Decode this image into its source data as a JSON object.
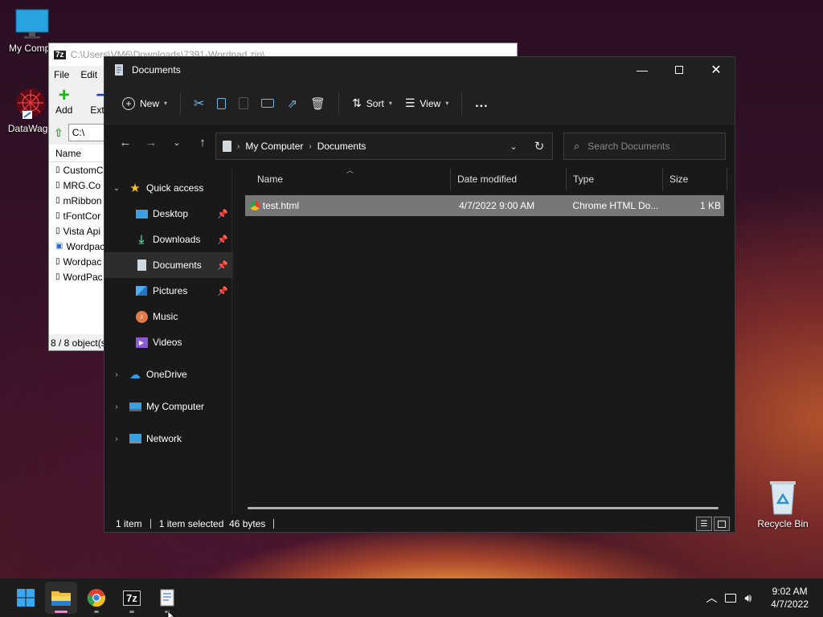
{
  "desktop": {
    "icons": [
      {
        "label": "My Compu",
        "icon": "monitor-icon"
      },
      {
        "label": "DataWago",
        "icon": "datawagon-icon"
      },
      {
        "label": "Recycle Bin",
        "icon": "recycle-bin-icon"
      }
    ]
  },
  "zip_window": {
    "title": "C:\\Users\\VM6\\Downloads\\7391-Wordpad.zip\\",
    "app_badge": "7z",
    "menu": [
      "File",
      "Edit"
    ],
    "toolbar": {
      "add": "Add",
      "extract": "Extra"
    },
    "path": "C:\\",
    "column_name": "Name",
    "files": [
      "CustomC",
      "MRG.Co",
      "mRibbon",
      "tFontCor",
      "Vista Api",
      "Wordpac",
      "Wordpac",
      "WordPac"
    ],
    "status": "8 / 8 object(s"
  },
  "explorer": {
    "title": "Documents",
    "commands": {
      "new": "New",
      "sort": "Sort",
      "view": "View",
      "more": "..."
    },
    "breadcrumb": [
      "My Computer",
      "Documents"
    ],
    "search_placeholder": "Search Documents",
    "nav": {
      "quick_access": "Quick access",
      "desktop": "Desktop",
      "downloads": "Downloads",
      "documents": "Documents",
      "pictures": "Pictures",
      "music": "Music",
      "videos": "Videos",
      "onedrive": "OneDrive",
      "my_computer": "My Computer",
      "network": "Network"
    },
    "columns": {
      "name": "Name",
      "date": "Date modified",
      "type": "Type",
      "size": "Size"
    },
    "files": [
      {
        "name": "test.html",
        "date": "4/7/2022 9:00 AM",
        "type": "Chrome HTML Do...",
        "size": "1 KB"
      }
    ],
    "status": {
      "count": "1 item",
      "selected": "1 item selected  46 bytes"
    }
  },
  "taskbar": {
    "time": "9:02 AM",
    "date": "4/7/2022",
    "seven_zip_label": "7z"
  },
  "colors": {
    "accent": "#e08fc4",
    "selection": "#777777"
  }
}
